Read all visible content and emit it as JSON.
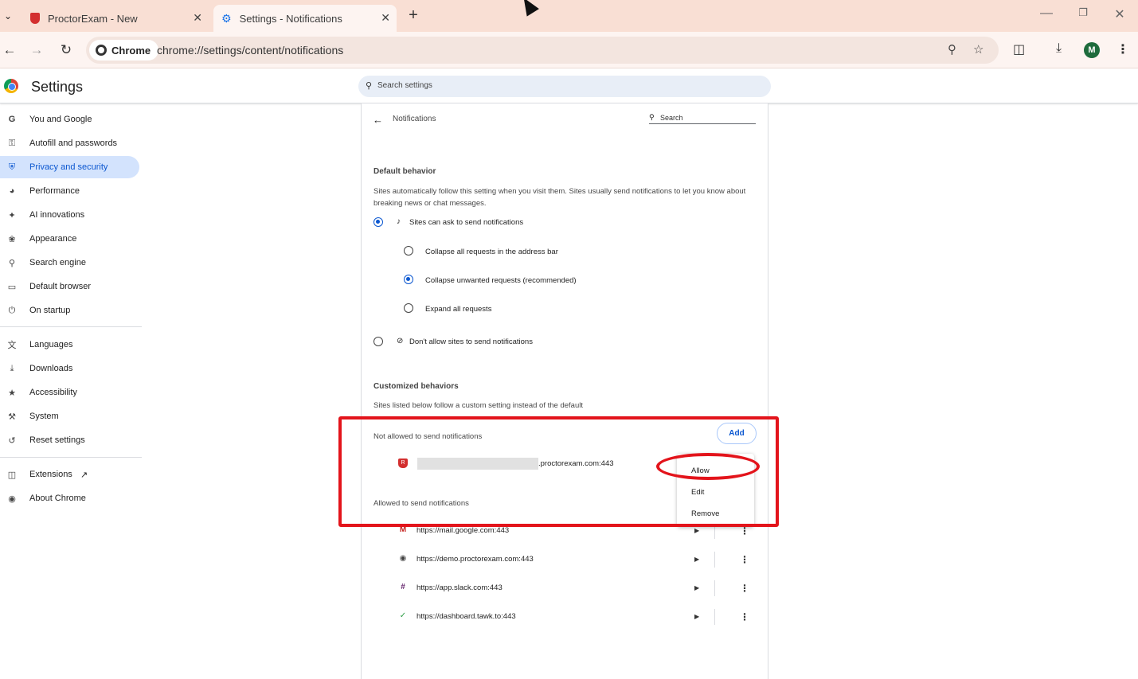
{
  "browser": {
    "tabs": [
      {
        "title": "ProctorExam - New",
        "active": false
      },
      {
        "title": "Settings - Notifications",
        "active": true
      }
    ],
    "new_tab_label": "+",
    "omnibox": {
      "chip_label": "Chrome",
      "url": "chrome://settings/content/notifications"
    },
    "profile_initial": "M"
  },
  "settings": {
    "title": "Settings",
    "search_placeholder": "Search settings",
    "nav": [
      {
        "label": "You and Google",
        "icon": "google-g-icon"
      },
      {
        "label": "Autofill and passwords",
        "icon": "key-icon"
      },
      {
        "label": "Privacy and security",
        "icon": "shield-icon",
        "active": true
      },
      {
        "label": "Performance",
        "icon": "speedometer-icon"
      },
      {
        "label": "AI innovations",
        "icon": "sparkle-icon"
      },
      {
        "label": "Appearance",
        "icon": "palette-icon"
      },
      {
        "label": "Search engine",
        "icon": "search-icon"
      },
      {
        "label": "Default browser",
        "icon": "browser-window-icon"
      },
      {
        "label": "On startup",
        "icon": "power-icon"
      },
      {
        "label": "Languages",
        "icon": "translate-icon"
      },
      {
        "label": "Downloads",
        "icon": "download-icon"
      },
      {
        "label": "Accessibility",
        "icon": "accessibility-icon"
      },
      {
        "label": "System",
        "icon": "wrench-icon"
      },
      {
        "label": "Reset settings",
        "icon": "reset-icon"
      },
      {
        "label": "Extensions",
        "icon": "puzzle-icon"
      },
      {
        "label": "About Chrome",
        "icon": "chrome-icon"
      }
    ]
  },
  "notifications": {
    "page_title": "Notifications",
    "search_label": "Search",
    "default_behavior": {
      "heading": "Default behavior",
      "description": "Sites automatically follow this setting when you visit them. Sites usually send notifications to let you know about breaking news or chat messages.",
      "option_allow": "Sites can ask to send notifications",
      "sub_options": [
        {
          "label": "Collapse all requests in the address bar",
          "selected": false
        },
        {
          "label": "Collapse unwanted requests (recommended)",
          "selected": true
        },
        {
          "label": "Expand all requests",
          "selected": false
        }
      ],
      "option_block": "Don't allow sites to send notifications",
      "allow_selected": true
    },
    "customized": {
      "heading": "Customized behaviors",
      "description": "Sites listed below follow a custom setting instead of the default",
      "not_allowed_heading": "Not allowed to send notifications",
      "add_label": "Add",
      "blocked_sites": [
        ".proctorexam.com:443"
      ],
      "allowed_heading": "Allowed to send notifications",
      "allowed_sites": [
        {
          "url": "https://mail.google.com:443",
          "icon": "gmail-icon"
        },
        {
          "url": "https://demo.proctorexam.com:443",
          "icon": "globe-icon"
        },
        {
          "url": "https://app.slack.com:443",
          "icon": "slack-icon"
        },
        {
          "url": "https://dashboard.tawk.to:443",
          "icon": "tawk-icon"
        }
      ]
    },
    "context_menu": [
      "Allow",
      "Edit",
      "Remove"
    ]
  },
  "colors": {
    "annotation": "#e3141b",
    "accent": "#0b57d0",
    "tab_strip": "#f9dfd4"
  }
}
